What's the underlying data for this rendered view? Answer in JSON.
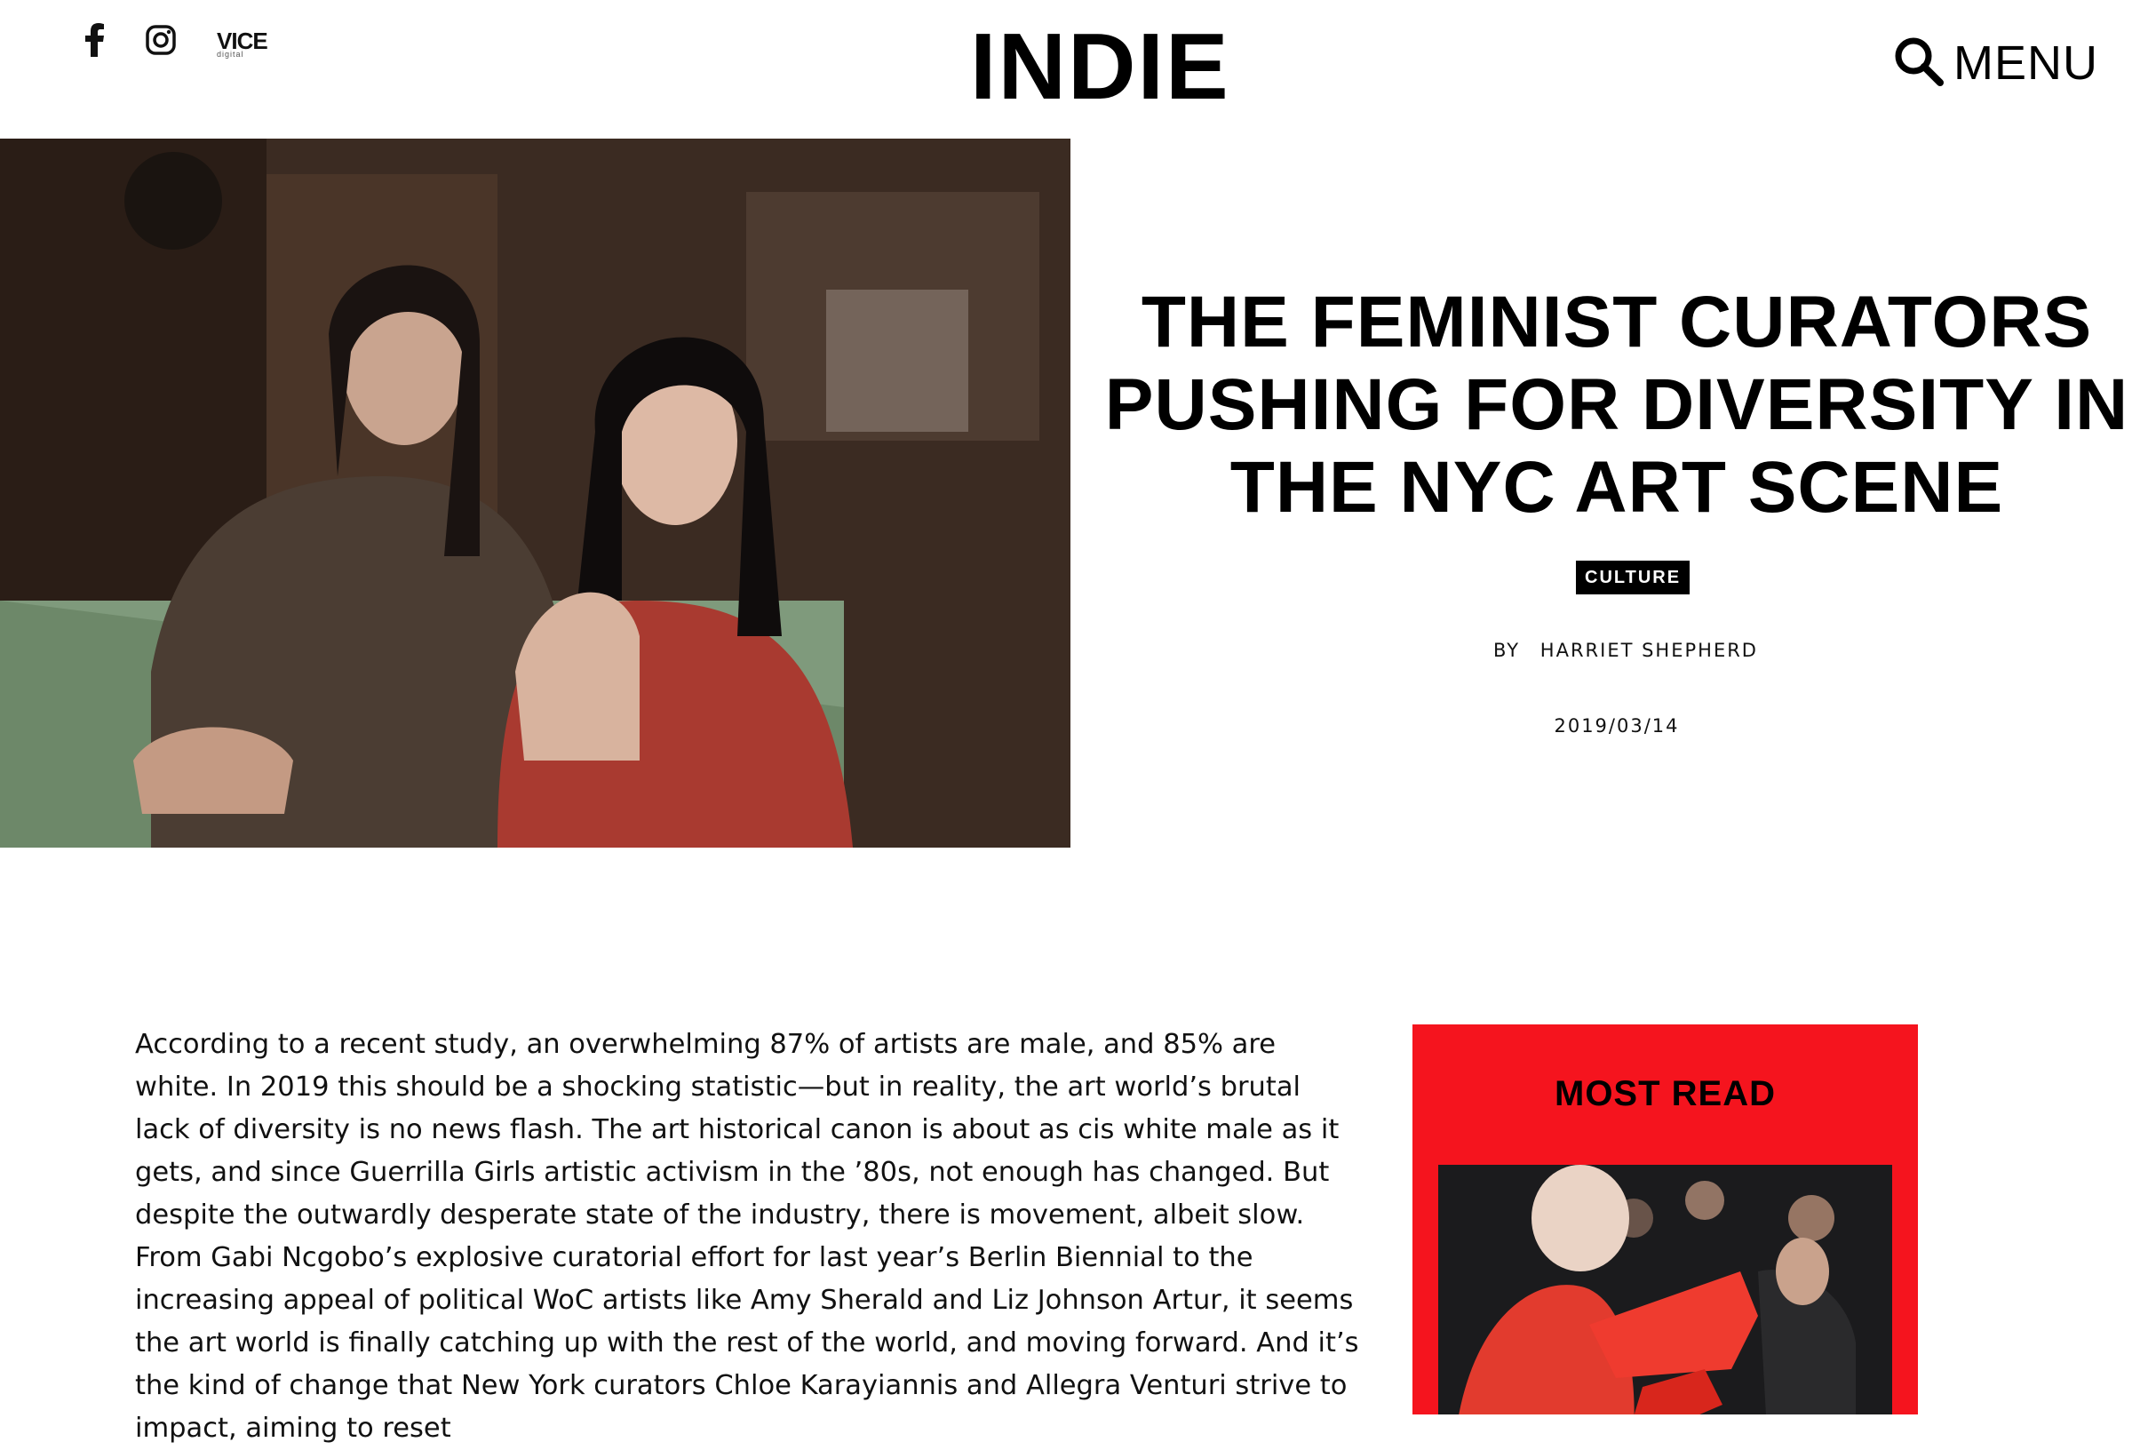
{
  "header": {
    "logo": "INDIE",
    "vice_label": "VICE",
    "vice_sub": "digital",
    "menu_label": "MENU",
    "social_icons": [
      "facebook-icon",
      "instagram-icon",
      "vice-icon"
    ],
    "search_icon": "search-icon"
  },
  "article": {
    "headline": "THE FEMINIST CURATORS PUSHING FOR DIVERSITY IN THE NYC ART SCENE",
    "category": "CULTURE",
    "by_label": "BY",
    "author": "HARRIET SHEPHERD",
    "date": "2019/03/14",
    "body": "According to a recent study, an overwhelming 87% of artists are male, and 85% are white. In 2019 this should be a shocking statistic—but in reality, the art world’s brutal lack of diversity is no news flash. The art historical canon is about as cis white male as it gets, and since Guerrilla Girls artistic activism in the ’80s, not enough has changed. But despite the outwardly desperate state of the industry, there is movement, albeit slow. From Gabi Ncgobo’s explosive curatorial effort for last year’s Berlin Biennial to the increasing appeal of political WoC artists like Amy Sherald and Liz Johnson Artur, it seems the art world is finally catching up with the rest of the world, and moving forward. And it’s the kind of change that New York curators Chloe Karayiannis and Allegra Venturi strive to impact, aiming to reset"
  },
  "sidebar": {
    "title": "MOST READ"
  },
  "colors": {
    "sidebar_bg": "#f5141e",
    "tag_bg": "#000000",
    "text": "#111111"
  }
}
